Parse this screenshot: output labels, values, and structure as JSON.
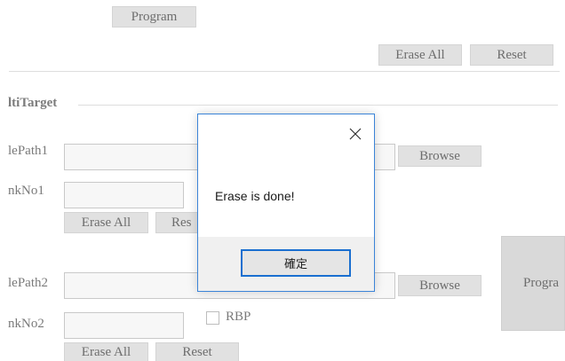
{
  "top": {
    "program_label": "Program",
    "erase_all_label": "Erase All",
    "reset_label": "Reset"
  },
  "group": {
    "title": "ltiTarget"
  },
  "target1": {
    "file_path_label": "lePath1",
    "bank_no_label": "nkNo1",
    "file_path_value": "",
    "bank_no_value": "",
    "browse_label": "Browse",
    "erase_all_label": "Erase All",
    "reset_label": "Res"
  },
  "target2": {
    "file_path_label": "lePath2",
    "bank_no_label": "nkNo2",
    "file_path_value": "",
    "bank_no_value": "",
    "browse_label": "Browse",
    "rbp_label": "RBP",
    "erase_all_label": "Erase All",
    "reset_label": "Reset"
  },
  "program_big_label": "Progra",
  "dialog": {
    "message": "Erase is done!",
    "ok_label": "確定"
  },
  "colors": {
    "dialog_border": "#3b84d8",
    "ok_border": "#1a6fd0",
    "button_bg": "#e1e1e1",
    "footer_bg": "#f0f0f0"
  }
}
